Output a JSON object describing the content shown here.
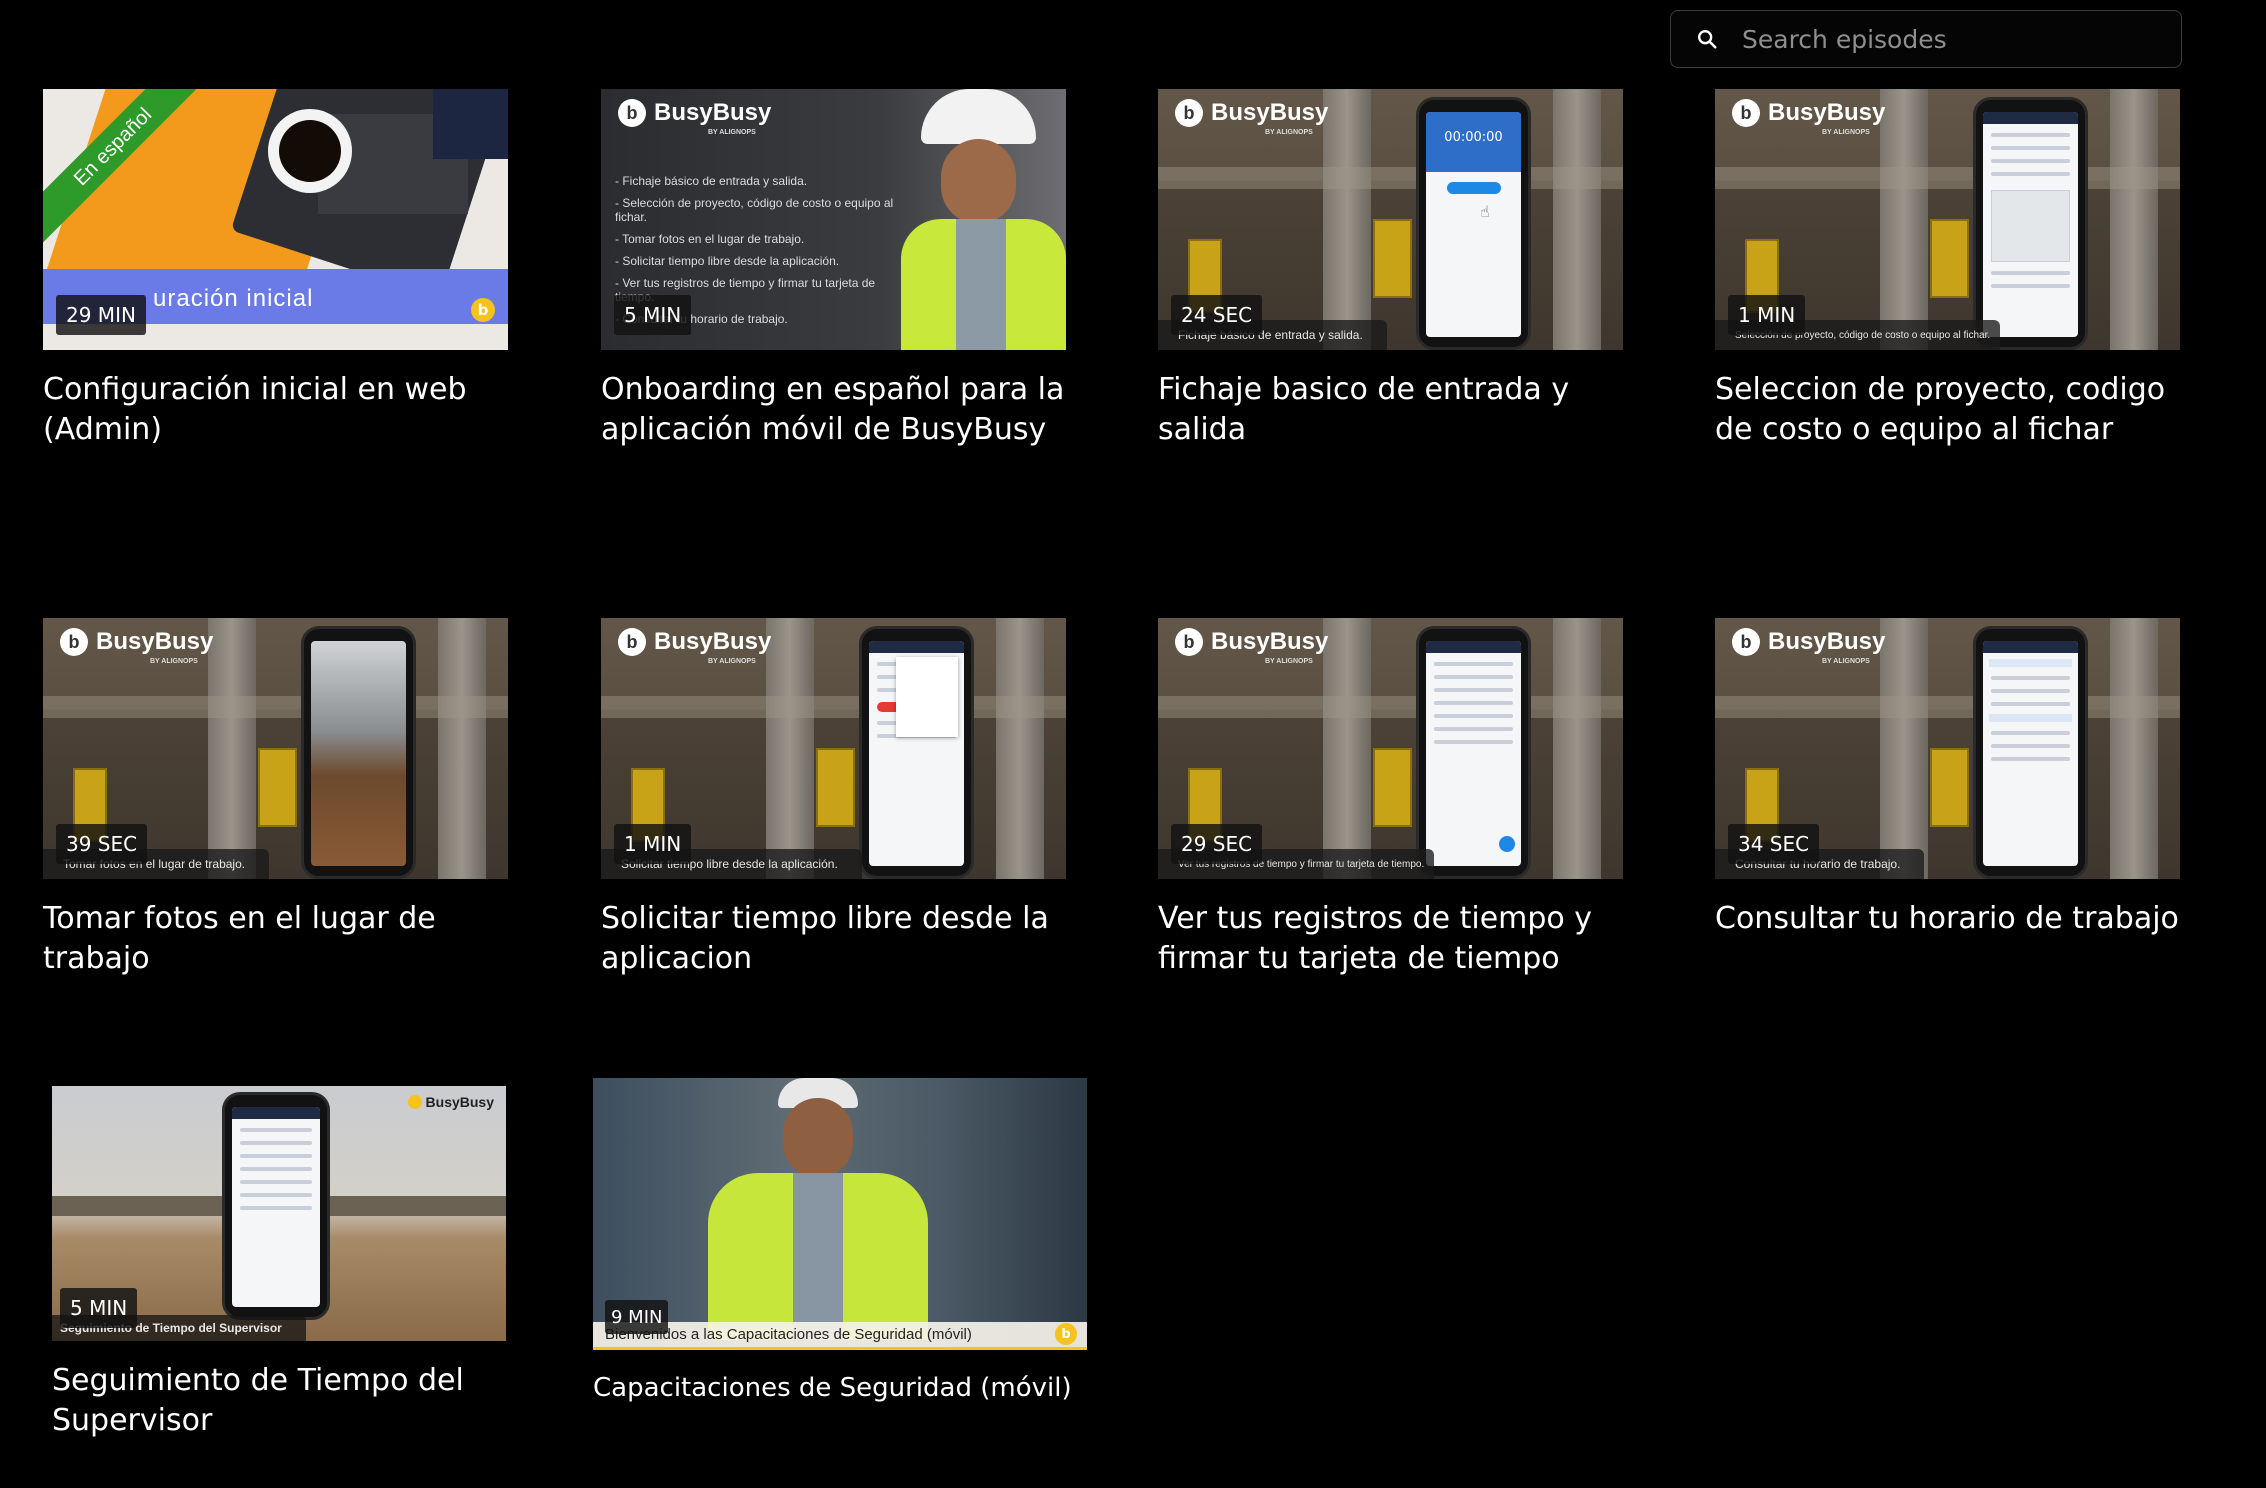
{
  "search": {
    "placeholder": "Search episodes"
  },
  "colors": {
    "background": "#000000",
    "accent_yellow": "#f5c31b",
    "banner_blue": "#6a7be8"
  },
  "episodes": [
    {
      "duration": "29 MIN",
      "title": "Configuración inicial en web (Admin)",
      "thumb_badge": "En español",
      "thumb_banner": "uración inicial"
    },
    {
      "duration": "5 MIN",
      "title": "Onboarding en español para la aplicación móvil de BusyBusy",
      "brand": "BusyBusy",
      "brand_sub": "BY ALIGNOPS",
      "bullets": [
        "- Fichaje básico de entrada y salida.",
        "- Selección de proyecto, código de costo o equipo al fichar.",
        "- Tomar fotos en el lugar de trabajo.",
        "- Solicitar tiempo libre desde la aplicación.",
        "- Ver tus registros de tiempo y firmar tu tarjeta de tiempo.",
        "- Consultar tu horario de trabajo."
      ]
    },
    {
      "duration": "24 SEC",
      "title": "Fichaje basico de entrada y salida",
      "brand": "BusyBusy",
      "brand_sub": "BY ALIGNOPS",
      "caption": "Fichaje básico de entrada y salida.",
      "phone_clock": "00:00:00"
    },
    {
      "duration": "1 MIN",
      "title": "Seleccion de proyecto, codigo de costo o equipo al fichar",
      "brand": "BusyBusy",
      "brand_sub": "BY ALIGNOPS",
      "caption": "Selección de proyecto, código de costo o equipo al fichar."
    },
    {
      "duration": "39 SEC",
      "title": "Tomar fotos en el lugar de trabajo",
      "brand": "BusyBusy",
      "brand_sub": "BY ALIGNOPS",
      "caption": "Tomar fotos en el lugar de trabajo."
    },
    {
      "duration": "1 MIN",
      "title": "Solicitar tiempo libre desde la aplicacion",
      "brand": "BusyBusy",
      "brand_sub": "BY ALIGNOPS",
      "caption": "Solicitar tiempo libre desde la aplicación."
    },
    {
      "duration": "29 SEC",
      "title": "Ver tus registros de tiempo y firmar tu tarjeta de tiempo",
      "brand": "BusyBusy",
      "brand_sub": "BY ALIGNOPS",
      "caption": "Ver tus registros de tiempo y firmar tu tarjeta de tiempo."
    },
    {
      "duration": "34 SEC",
      "title": "Consultar tu horario de trabajo",
      "brand": "BusyBusy",
      "brand_sub": "BY ALIGNOPS",
      "caption": "Consultar tu horario de trabajo."
    },
    {
      "duration": "5 MIN",
      "title": "Seguimiento de Tiempo del Supervisor",
      "brand": "BusyBusy",
      "caption": "Seguimiento de Tiempo del Supervisor"
    },
    {
      "duration": "9 MIN",
      "title": "Capacitaciones de Seguridad (móvil)",
      "caption": "Bienvenidos a las Capacitaciones de Seguridad (móvil)"
    }
  ]
}
